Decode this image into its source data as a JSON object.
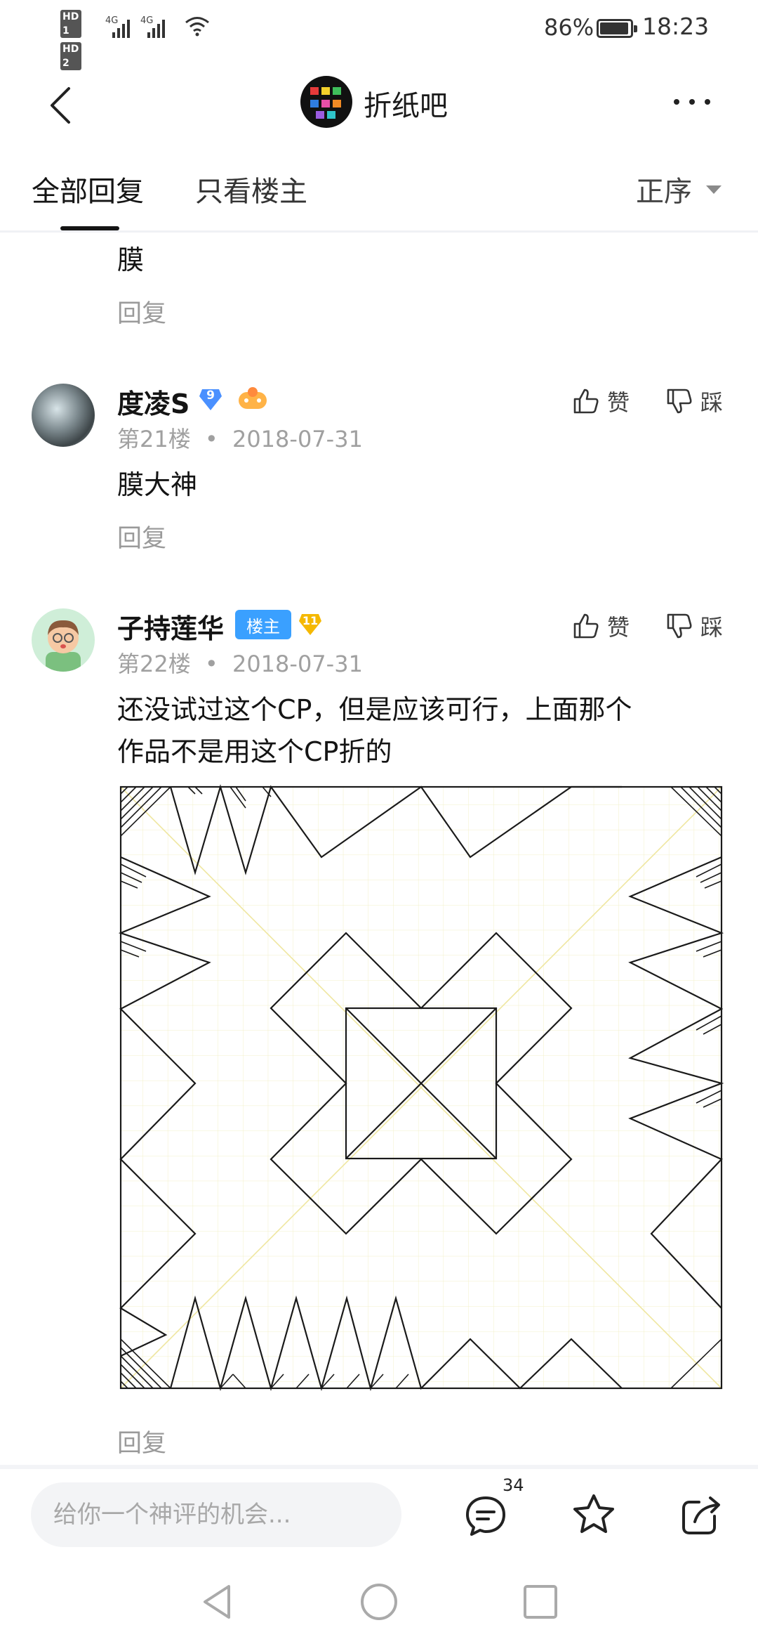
{
  "status_bar": {
    "hd1": "HD 1",
    "hd2": "HD 2",
    "net1": "4G",
    "net2": "4G",
    "battery": "86%",
    "time": "18:23"
  },
  "header": {
    "forum_name": "折纸吧",
    "back_icon": "back-chevron-icon",
    "more_icon": "more-dots-icon"
  },
  "tabs": {
    "all": "全部回复",
    "owner_only": "只看楼主",
    "sort": "正序"
  },
  "posts": [
    {
      "text": "膜",
      "reply_label": "回复"
    },
    {
      "user": "度凌S",
      "level": "9",
      "floor": "第21楼",
      "date": "2018-07-31",
      "text": "膜大神",
      "like": "赞",
      "dislike": "踩",
      "reply_label": "回复"
    },
    {
      "user": "子持莲华",
      "owner_badge": "楼主",
      "level": "11",
      "floor": "第22楼",
      "date": "2018-07-31",
      "text_line1": "还没试过这个CP，但是应该可行，上面那个",
      "text_line2": "作品不是用这个CP折的",
      "like": "赞",
      "dislike": "踩",
      "reply_label": "回复"
    }
  ],
  "separator": "•",
  "bottom_bar": {
    "placeholder": "给你一个神评的机会...",
    "comment_count": "34"
  },
  "colors": {
    "accent_blue": "#3aa0ff",
    "level_gold": "#f5b800",
    "level_blue": "#4a90ff",
    "gray_text": "#a0a0a0"
  }
}
